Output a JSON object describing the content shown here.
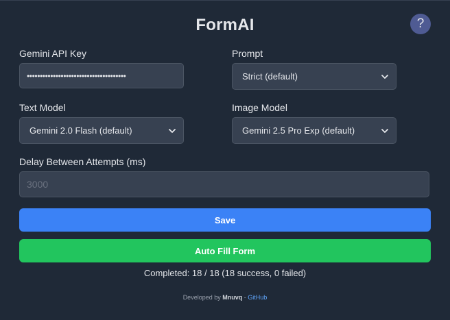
{
  "app": {
    "title": "FormAI",
    "help_label": "?"
  },
  "fields": {
    "api_key": {
      "label": "Gemini API Key",
      "value": "••••••••••••••••••••••••••••••••••••••"
    },
    "prompt": {
      "label": "Prompt",
      "selected": "Strict (default)"
    },
    "text_model": {
      "label": "Text Model",
      "selected": "Gemini 2.0 Flash (default)"
    },
    "image_model": {
      "label": "Image Model",
      "selected": "Gemini 2.5 Pro Exp (default)"
    },
    "delay": {
      "label": "Delay Between Attempts (ms)",
      "placeholder": "3000",
      "value": ""
    }
  },
  "buttons": {
    "save": "Save",
    "auto_fill": "Auto Fill Form"
  },
  "status": {
    "text": "Completed: 18 / 18 (18 success, 0 failed)"
  },
  "footer": {
    "prefix": "Developed by",
    "author": "Mnuvq",
    "separator": "-",
    "link": "GitHub"
  },
  "colors": {
    "background": "#1f2937",
    "field_bg": "#374151",
    "save": "#3b82f6",
    "auto_fill": "#22c55e",
    "help": "#4f5b93",
    "link": "#60a5fa"
  },
  "icons": {
    "select_arrow": "chevron-down-icon",
    "help": "question-mark-icon"
  }
}
